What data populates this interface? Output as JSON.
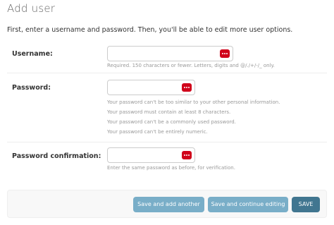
{
  "page": {
    "title": "Add user",
    "intro": "First, enter a username and password. Then, you'll be able to edit more user options."
  },
  "form": {
    "username": {
      "label": "Username:",
      "value": "",
      "help": "Required. 150 characters or fewer. Letters, digits and @/./+/-/_ only."
    },
    "password": {
      "label": "Password:",
      "value": "",
      "help": [
        "Your password can't be too similar to your other personal information.",
        "Your password must contain at least 8 characters.",
        "Your password can't be a commonly used password.",
        "Your password can't be entirely numeric."
      ]
    },
    "password_confirmation": {
      "label": "Password confirmation:",
      "value": "",
      "help": "Enter the same password as before, for verification."
    }
  },
  "buttons": {
    "save_add_another": "Save and add another",
    "save_continue": "Save and continue editing",
    "save": "SAVE"
  },
  "icons": {
    "password_manager": "password-manager-icon"
  },
  "colors": {
    "button_secondary": "#79aec8",
    "button_primary": "#417690",
    "password_manager_badge": "#d0021b"
  }
}
